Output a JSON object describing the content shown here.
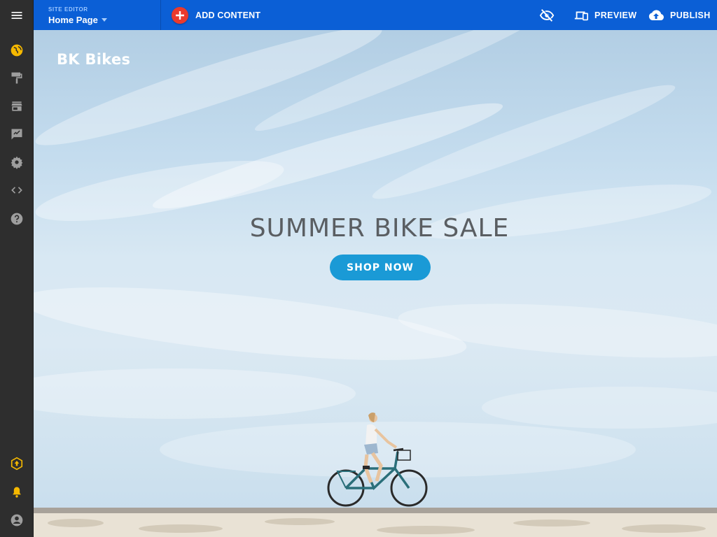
{
  "topbar": {
    "site_editor_caption": "SITE EDITOR",
    "page_selector": "Home Page",
    "add_content": "ADD CONTENT",
    "preview": "PREVIEW",
    "publish": "PUBLISH"
  },
  "sidebar": {
    "icons": [
      "menu-icon",
      "globe-icon",
      "paint-roller-icon",
      "store-icon",
      "feedback-icon",
      "settings-icon",
      "code-icon",
      "help-icon",
      "upgrade-icon",
      "notifications-icon",
      "account-icon"
    ]
  },
  "hero": {
    "brand": "BK Bikes",
    "headline": "SUMMER BIKE SALE",
    "cta": "SHOP NOW"
  },
  "colors": {
    "topbar": "#0b5fd6",
    "sidebar": "#2e2e2e",
    "accent_icon": "#f5b800",
    "add_button": "#ea3a2d",
    "cta": "#1a9ad6"
  }
}
